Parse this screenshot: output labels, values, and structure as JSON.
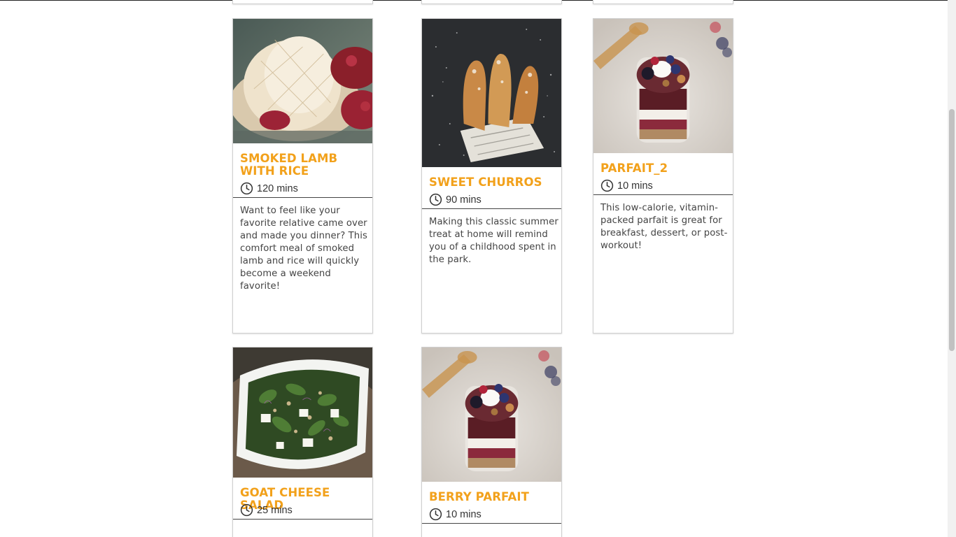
{
  "cards": [
    {
      "title": "Smoked Lamb with Rice",
      "time": "120 mins",
      "description": "Want to feel like your favorite relative came over and made you dinner? This comfort meal of smoked lamb and rice will quickly become a weekend favorite!"
    },
    {
      "title": "Sweet Churros",
      "time": "90 mins",
      "description": "Making this classic summer treat at home will remind you of a childhood spent in the park."
    },
    {
      "title": "Parfait_2",
      "time": "10 mins",
      "description": "This low-calorie, vitamin-packed parfait is great for breakfast, dessert, or post-workout!"
    },
    {
      "title": "Goat Cheese Salad",
      "time": "25 mins",
      "description": ""
    },
    {
      "title": "Berry Parfait",
      "time": "10 mins",
      "description": ""
    }
  ],
  "colors": {
    "title": "#f2a11b",
    "text": "#444444",
    "scroll_thumb": "#c1c1c1"
  },
  "icons": {
    "time": "clock-icon"
  },
  "scrollbar": {
    "position_fraction": 0.37
  }
}
